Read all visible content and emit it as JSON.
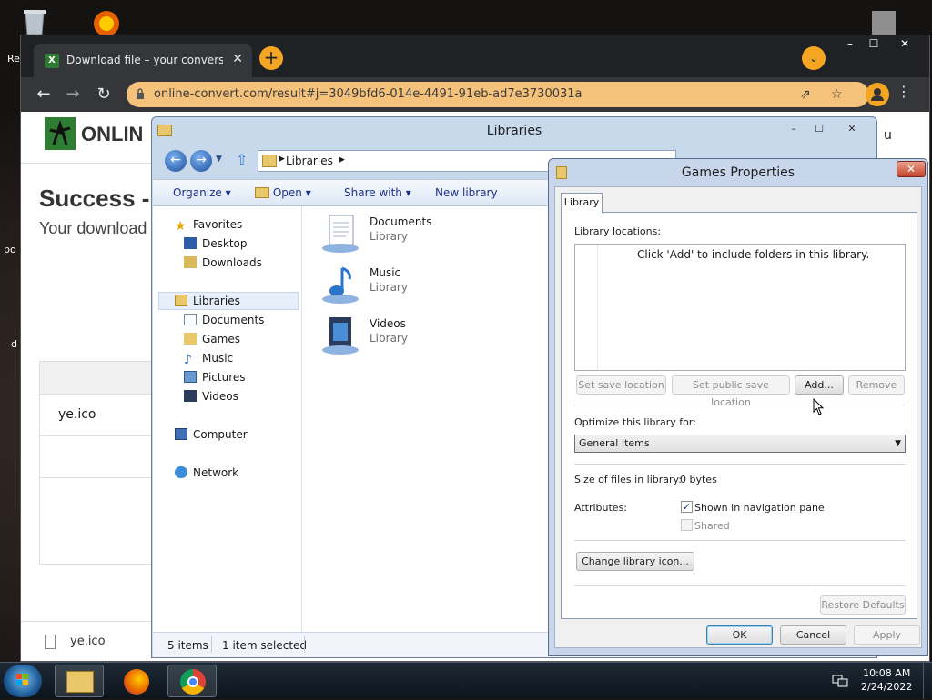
{
  "desktop": {
    "left_labels": [
      "Re",
      "po",
      "d"
    ]
  },
  "browser": {
    "tab_title": "Download file – your conversion",
    "tab_favicon_letter": "X",
    "url": "online-convert.com/result#j=3049bfd6-014e-4491-91eb-ad7e3730031a",
    "window_controls": [
      "–",
      "☐",
      "✕"
    ],
    "page": {
      "site_name": "ONLINE-CONVERT",
      "site_name_visible": "ONLIN",
      "success_heading": "Success -",
      "subtitle": "Your download",
      "file_row": "ye.ico",
      "right_edge_text": "u",
      "download_bar_file": "ye.ico"
    }
  },
  "explorer": {
    "title": "Libraries",
    "breadcrumb": "Libraries",
    "window_controls": [
      "–",
      "☐",
      "✕"
    ],
    "toolbar": {
      "organize": "Organize",
      "open": "Open",
      "share_with": "Share with",
      "new_library": "New library"
    },
    "nav": {
      "favorites": "Favorites",
      "desktop": "Desktop",
      "downloads": "Downloads",
      "libraries": "Libraries",
      "documents": "Documents",
      "games": "Games",
      "music": "Music",
      "pictures": "Pictures",
      "videos": "Videos",
      "computer": "Computer",
      "network": "Network"
    },
    "items": [
      {
        "name": "Documents",
        "type": "Library"
      },
      {
        "name": "Music",
        "type": "Library"
      },
      {
        "name": "Videos",
        "type": "Library"
      }
    ],
    "status": {
      "count": "5 items",
      "selected": "1 item selected"
    }
  },
  "dialog": {
    "title": "Games Properties",
    "tab": "Library",
    "library_locations_label": "Library locations:",
    "empty_hint": "Click 'Add' to include folders in this library.",
    "buttons": {
      "set_save": "Set save location",
      "set_public_save": "Set public save location",
      "add": "Add...",
      "remove": "Remove",
      "change_icon": "Change library icon...",
      "restore": "Restore Defaults",
      "ok": "OK",
      "cancel": "Cancel",
      "apply": "Apply"
    },
    "optimize_label": "Optimize this library for:",
    "optimize_value": "General Items",
    "size_label": "Size of files in library:",
    "size_value": "0 bytes",
    "attributes_label": "Attributes:",
    "shown_in_nav": "Shown in navigation pane",
    "shown_in_nav_checked": true,
    "shared": "Shared",
    "shared_checked": false
  },
  "taskbar": {
    "time": "10:08 AM",
    "date": "2/24/2022"
  }
}
